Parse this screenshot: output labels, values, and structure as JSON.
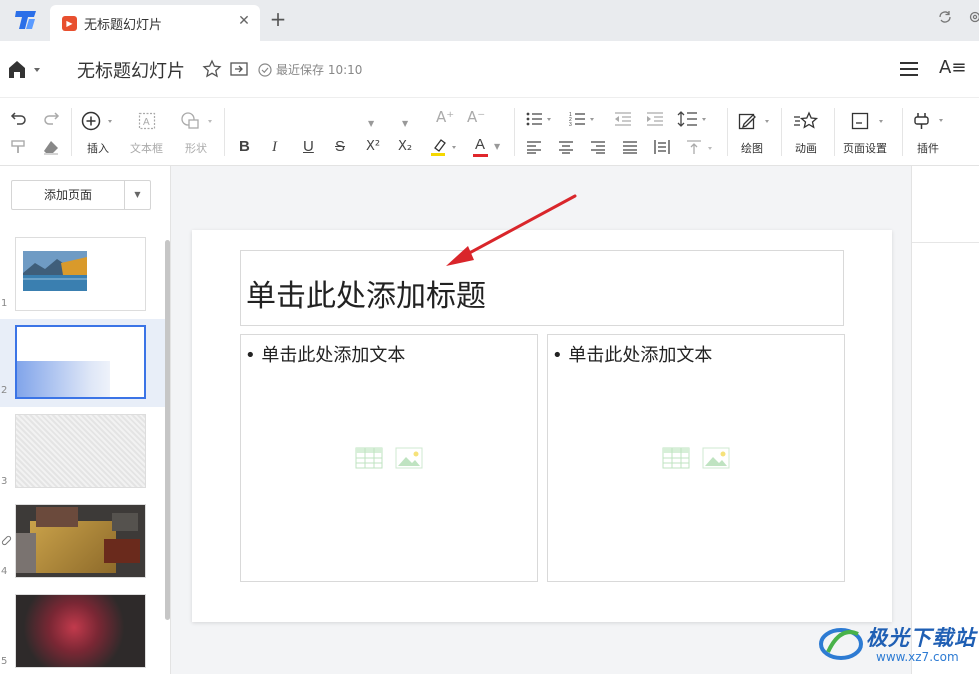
{
  "tabbar": {
    "tab_title": "无标题幻灯片",
    "tab_close": "✕",
    "new_tab": "+"
  },
  "header": {
    "doc_title": "无标题幻灯片",
    "save_status": "最近保存 10:10",
    "font_panel": "A≡"
  },
  "toolbar": {
    "insert_label": "插入",
    "textbox_label": "文本框",
    "shape_label": "形状",
    "bold": "B",
    "italic": "I",
    "underline": "U",
    "strike": "S",
    "superscript": "X²",
    "subscript": "X₂",
    "font_color": "A",
    "grow_font": "A⁺",
    "shrink_font": "A⁻",
    "draw_label": "绘图",
    "animation_label": "动画",
    "page_setup_label": "页面设置",
    "plugins_label": "插件"
  },
  "left_panel": {
    "add_page_label": "添加页面",
    "slides": [
      {
        "num": "1"
      },
      {
        "num": "2"
      },
      {
        "num": "3"
      },
      {
        "num": "4"
      },
      {
        "num": "5"
      }
    ]
  },
  "slide": {
    "title_placeholder": "单击此处添加标题",
    "left_body_placeholder": "• 单击此处添加文本",
    "right_body_placeholder": "• 单击此处添加文本"
  },
  "watermark": {
    "name": "极光下载站",
    "url": "www.xz7.com"
  },
  "colors": {
    "accent": "#3b74e6",
    "arrow": "#d9262b",
    "tab_icon": "#e8502f",
    "highlight_bar": "#f5d800",
    "font_color_bar": "#e0262b"
  }
}
